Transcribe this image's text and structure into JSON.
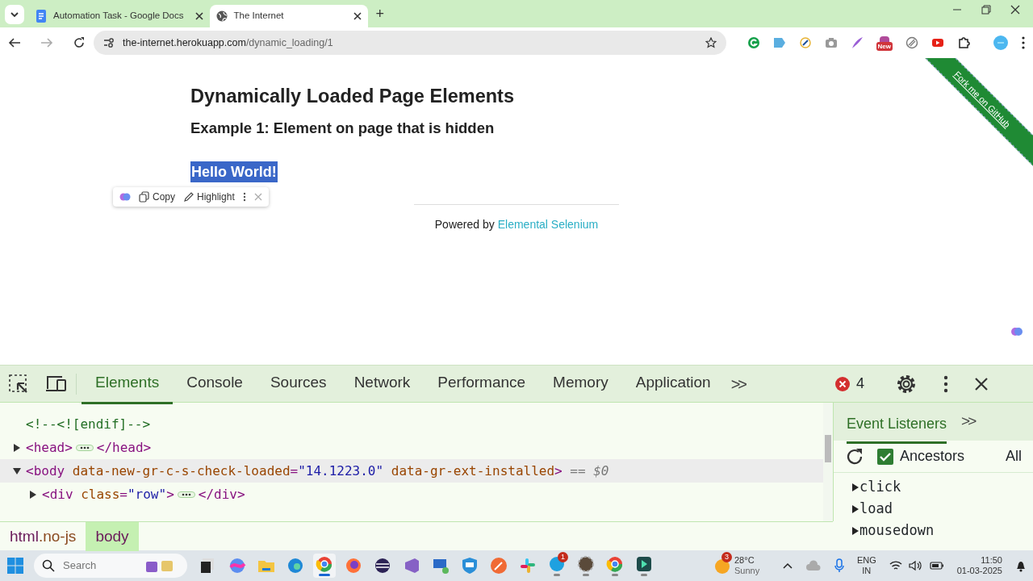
{
  "browser": {
    "tabs": [
      {
        "title": "Automation Task - Google Docs",
        "selected": false
      },
      {
        "title": "The Internet",
        "selected": true
      }
    ],
    "new_tab": "+",
    "address": {
      "host": "the-internet.herokuapp.com",
      "path": "/dynamic_loading/1"
    },
    "extension_badge": "New"
  },
  "page": {
    "heading": "Dynamically Loaded Page Elements",
    "subheading": "Example 1: Element on page that is hidden",
    "result": "Hello World!",
    "result_selected": true,
    "popup": [
      "Copy",
      "Highlight"
    ],
    "footer_prefix": "Powered by",
    "footer_link": "Elemental Selenium",
    "ribbon": "Fork me on GitHub"
  },
  "devtools": {
    "tabs": [
      {
        "label": "Elements",
        "selected": true
      },
      {
        "label": "Console",
        "selected": false
      },
      {
        "label": "Sources",
        "selected": false
      },
      {
        "label": "Network",
        "selected": false
      },
      {
        "label": "Performance",
        "selected": false
      },
      {
        "label": "Memory",
        "selected": false
      },
      {
        "label": "Application",
        "selected": false
      }
    ],
    "more": ">>",
    "error_count": "4",
    "dom": [
      {
        "kind": "comment",
        "selected": false,
        "before": [
          {
            "kind": "comment",
            "t": "<!--<![endif]-->"
          }
        ]
      },
      {
        "kind": "element",
        "expanded": false,
        "selected": false,
        "before": [
          {
            "kind": "tag",
            "t": "<head>"
          }
        ],
        "after": [
          {
            "kind": "tag",
            "t": "</head>"
          }
        ]
      },
      {
        "kind": "element",
        "expanded": true,
        "selected": true,
        "before": [
          {
            "kind": "tag",
            "t": "<body"
          },
          {
            "kind": "attr",
            "t": " data-new-gr-c-s-check-loaded"
          },
          {
            "kind": "tag",
            "t": "="
          },
          {
            "kind": "value",
            "t": "\"14.1223.0\""
          },
          {
            "kind": "attr",
            "t": " data-gr-ext-installed"
          },
          {
            "kind": "tag",
            "t": ">"
          },
          {
            "kind": "ref",
            "t": " == $0"
          }
        ],
        "children": [
          {
            "kind": "element",
            "expanded": false,
            "selected": false,
            "before": [
              {
                "kind": "tag",
                "t": "<div"
              },
              {
                "kind": "attr",
                "t": " class"
              },
              {
                "kind": "tag",
                "t": "="
              },
              {
                "kind": "value",
                "t": "\"row\""
              },
              {
                "kind": "tag",
                "t": ">"
              }
            ],
            "after": [
              {
                "kind": "tag",
                "t": "</div>"
              }
            ]
          }
        ]
      }
    ],
    "breadcrumbs": [
      {
        "selected": false,
        "parts": [
          {
            "kind": "tag",
            "t": "html"
          },
          {
            "kind": "attr",
            "t": ".no-js"
          }
        ]
      },
      {
        "selected": true,
        "parts": [
          {
            "kind": "tag",
            "t": "body"
          }
        ]
      }
    ],
    "side": {
      "title": "Event Listeners",
      "more": ">>",
      "ancestors": {
        "label": "Ancestors",
        "checked": true
      },
      "filter": "All",
      "listeners": [
        {
          "name": "click",
          "expanded": false
        },
        {
          "name": "load",
          "expanded": false
        },
        {
          "name": "mousedown",
          "expanded": false
        }
      ]
    }
  },
  "taskbar": {
    "search": {
      "placeholder": "Search"
    },
    "apps": [
      {
        "kind": "window",
        "running": false,
        "active": false
      },
      {
        "kind": "orb",
        "running": false,
        "active": false
      },
      {
        "kind": "folder",
        "running": false,
        "active": false
      },
      {
        "kind": "wave",
        "running": false,
        "active": false
      },
      {
        "kind": "ring",
        "running": true,
        "active": true
      },
      {
        "kind": "fox",
        "running": false,
        "active": false
      },
      {
        "kind": "eclipse",
        "running": false,
        "active": false
      },
      {
        "kind": "ribbon",
        "running": false,
        "active": false
      },
      {
        "kind": "monitor",
        "running": false,
        "active": false
      },
      {
        "kind": "shield",
        "running": false,
        "active": false
      },
      {
        "kind": "pen",
        "running": false,
        "active": false
      },
      {
        "kind": "hash",
        "running": false,
        "active": false
      },
      {
        "kind": "chat",
        "running": true,
        "active": false,
        "badge": "1"
      },
      {
        "kind": "gear",
        "running": true,
        "active": false
      },
      {
        "kind": "ring",
        "running": true,
        "active": false
      },
      {
        "kind": "play",
        "running": true,
        "active": false
      }
    ],
    "weather": {
      "badge": "3",
      "temp": "28°C",
      "text": "Sunny"
    },
    "lang": [
      "ENG",
      "IN"
    ],
    "time": "11:50",
    "date": "01-03-2025"
  }
}
